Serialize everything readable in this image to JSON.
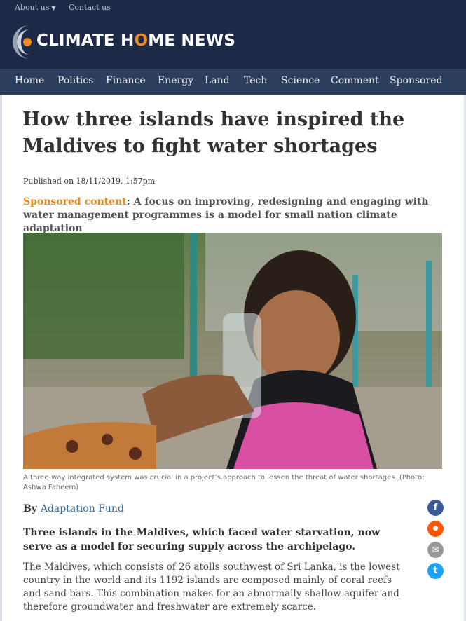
{
  "utility_nav": {
    "about_label": "About us",
    "contact_label": "Contact us"
  },
  "brand": {
    "name_part1": "CLIMATE H",
    "name_o": "O",
    "name_part2": "ME NEWS",
    "accent_color": "#f08a24",
    "bar_color": "#1d2a47"
  },
  "main_nav": {
    "items": [
      "Home",
      "Politics",
      "Finance",
      "Energy",
      "Land",
      "Tech",
      "Science",
      "Comment",
      "Sponsored"
    ]
  },
  "article": {
    "title": "How three islands have inspired the Maldives to fight water shortages",
    "published": "Published on 18/11/2019, 1:57pm",
    "sponsored_label": "Sponsored content",
    "standfirst": ": A focus on improving, redesigning and engaging with water management programmes is a model for small nation climate adaptation",
    "caption": "A three-way integrated system was crucial in a project’s approach to lessen the threat of water shortages. (Photo: Ashwa Faheem)",
    "byline_prefix": "By ",
    "author": "Adaptation Fund",
    "lede": "Three islands in the Maldives, which faced water starvation, now serve as a model for securing supply across the archipelago.",
    "paragraph_1": "The Maldives, which consists of 26 atolls southwest of Sri Lanka, is the lowest country in the world and its 1192 islands are composed mainly of coral reefs and sand bars. This combination makes for an abnormally shallow aquifer and therefore groundwater and freshwater are extremely scarce."
  },
  "share": {
    "facebook_glyph": "f",
    "reddit_glyph": "●",
    "email_glyph": "✉",
    "twitter_glyph": "t",
    "colors": {
      "facebook": "#3b5998",
      "reddit": "#ff5700",
      "email": "#999999",
      "twitter": "#1da1f2"
    }
  }
}
